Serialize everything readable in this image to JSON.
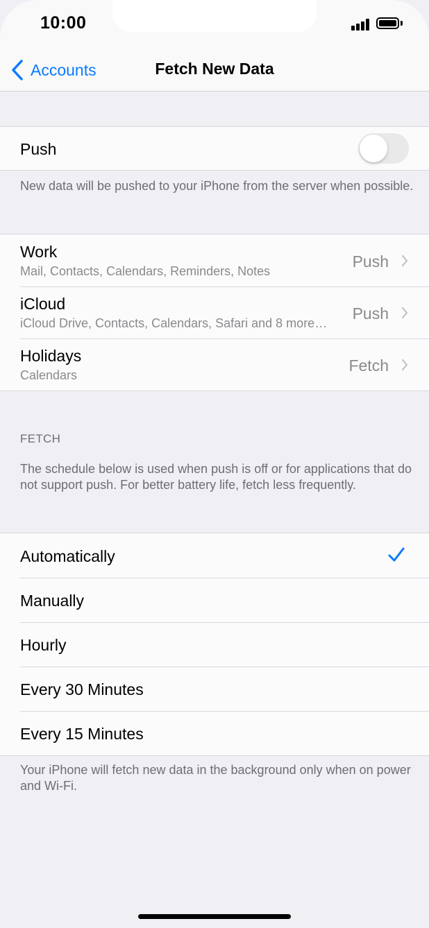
{
  "status_bar": {
    "time": "10:00"
  },
  "nav": {
    "back_label": "Accounts",
    "title": "Fetch New Data"
  },
  "push": {
    "label": "Push",
    "enabled": false,
    "footer": "New data will be pushed to your iPhone from the server when possible."
  },
  "accounts": [
    {
      "title": "Work",
      "subtitle": "Mail, Contacts, Calendars, Reminders, Notes",
      "value": "Push"
    },
    {
      "title": "iCloud",
      "subtitle": "iCloud Drive, Contacts, Calendars, Safari and 8 more…",
      "value": "Push"
    },
    {
      "title": "Holidays",
      "subtitle": "Calendars",
      "value": "Fetch"
    }
  ],
  "fetch": {
    "header": "FETCH",
    "description": "The schedule below is used when push is off or for applications that do not support push. For better battery life, fetch less frequently.",
    "options": [
      "Automatically",
      "Manually",
      "Hourly",
      "Every 30 Minutes",
      "Every 15 Minutes"
    ],
    "selected": "Automatically",
    "footer": "Your iPhone will fetch new data in the background only when on power and Wi-Fi."
  },
  "colors": {
    "accent": "#0a7aff",
    "background": "#efeff4",
    "toggle_off": "#e9e9ea"
  },
  "icons": [
    "chevron-left-icon",
    "chevron-right-icon",
    "checkmark-icon",
    "signal-icon",
    "battery-icon"
  ]
}
